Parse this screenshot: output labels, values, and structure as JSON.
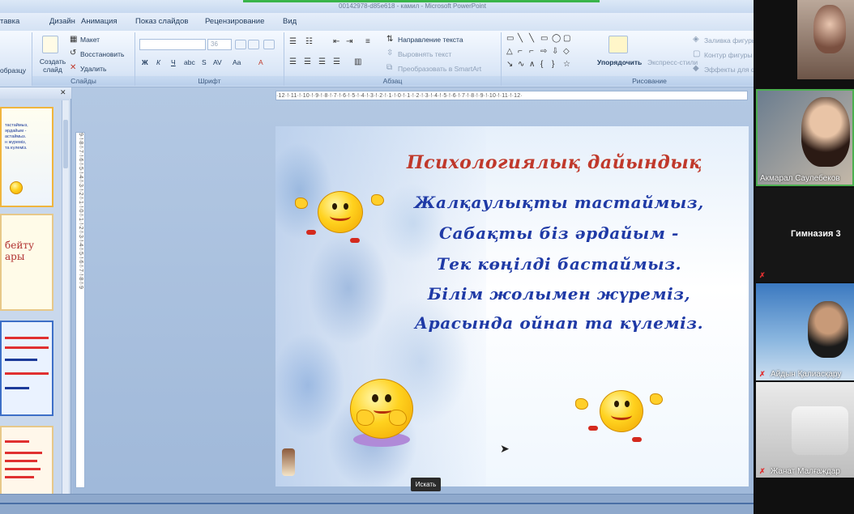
{
  "window": {
    "title": "00142978-d85e618 - камил - Microsoft PowerPoint"
  },
  "ribbon": {
    "tabs": [
      "тавка",
      "Дизайн",
      "Анимация",
      "Показ слайдов",
      "Рецензирование",
      "Вид"
    ],
    "slides_group": {
      "create_slide": "Создать слайд",
      "layout": "Макет",
      "restore": "Восстановить",
      "delete": "Удалить",
      "label": "Слайды",
      "paste_fragment": "образцу"
    },
    "font_group": {
      "font_name": "",
      "font_size": "36",
      "label": "Шрифт"
    },
    "paragraph_group": {
      "text_direction": "Направление текста",
      "align_text": "Выровнять текст",
      "smartart": "Преобразовать в SmartArt",
      "label": "Абзац"
    },
    "drawing_group": {
      "arrange": "Упорядочить",
      "quick_styles": "Экспресс-стили",
      "shape_fill": "Заливка фигуры",
      "shape_outline": "Контур фигуры",
      "shape_effects": "Эффекты для фигур",
      "label": "Рисование"
    }
  },
  "thumbnails": [
    {
      "lines": "тастаймыз,\nәрдайым -\nастаймыз.\nн жүреміз,\nта күлеміз."
    },
    {
      "title": "бейту\nары"
    },
    {
      "lines": "..."
    },
    {
      "lines": "..."
    }
  ],
  "slide": {
    "title": "Психологиялық дайындық",
    "verses": [
      "Жалқаулықты тастаймыз,",
      "Сабақты біз әрдайым -",
      "Тек көңілді бастаймыз.",
      "Білім жолымен жүреміз,",
      "Арасында ойнап та күлеміз."
    ]
  },
  "rulers": {
    "horizontal": "·12·!·11·!·10·!·9·!·8·!·7·!·6·!·5·!·4·!·3·!·2·!·1·!·0·!·1·!·2·!·3·!·4·!·5·!·6·!·7·!·8·!·9·!·10·!·11·!·12·",
    "vertical": "9·!·8·!·7·!·6·!·5·!·4·!·3·!·2·!·1·!·0·!·1·!·2·!·3·!·4·!·5·!·6·!·7·!·8·!·9"
  },
  "tooltip": {
    "text": "Искать"
  },
  "participants": [
    {
      "name": "Акмарал Саулебеков",
      "muted": false,
      "active": true
    },
    {
      "name": "Гимназия 3",
      "muted": true,
      "active": false
    },
    {
      "name": "Айдын Қалиасқару",
      "muted": true,
      "active": false
    },
    {
      "name": "Жанат Малғаждар",
      "muted": true,
      "active": false
    }
  ],
  "colors": {
    "slide_title": "#c0392b",
    "verse_text": "#1f3aa6",
    "ribbon_text": "#1e395b",
    "active_speaker": "#4caf50",
    "muted_icon": "#e03030"
  }
}
